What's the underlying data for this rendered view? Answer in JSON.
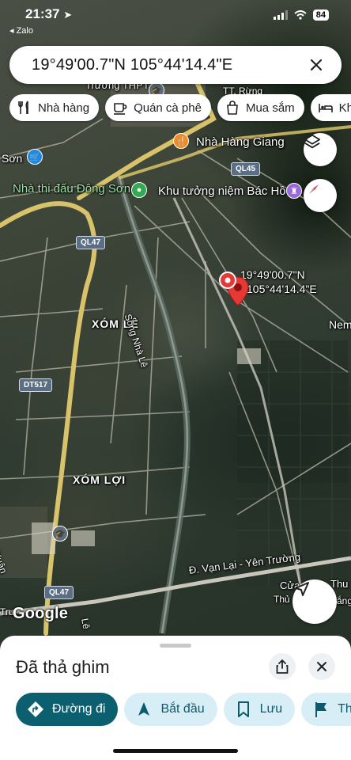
{
  "status_bar": {
    "time": "21:37",
    "back_app": "◂ Zalo",
    "battery": "84"
  },
  "search": {
    "query": "19°49'00.7\"N 105°44'14.4\"E"
  },
  "categories": [
    {
      "label": "Nhà hàng",
      "icon": "restaurant-icon"
    },
    {
      "label": "Quán cà phê",
      "icon": "coffee-icon"
    },
    {
      "label": "Mua sắm",
      "icon": "shopping-bag-icon"
    },
    {
      "label": "Khá",
      "icon": "hotel-icon"
    }
  ],
  "map": {
    "labels": {
      "school": "Trường THPT",
      "town": "TT. Rừng",
      "restaurant": "Nhà Hàng Giang",
      "son": "Sơn",
      "stadium": "Nhà thi đấu Đông Sơn",
      "memorial": "Khu tưởng niệm Bác Hồ",
      "pin_lat": "19°49'00.7\"N",
      "pin_lng": "105°44'14.4\"E",
      "nem": "Nem",
      "xom_le": "XÓM LÊ",
      "river": "Sông Nhà Lê",
      "xom_loi": "XÓM LỢI",
      "road": "Đ. Vạn Lại - Yên Trường",
      "cua": "Cửa",
      "thu_right": "Thu",
      "thu_bottom": "Thủ",
      "thang": "Thắng M",
      "xuan": "Xuân",
      "tru": "Trư",
      "le_bottom": "Lê"
    },
    "shields": {
      "ql45": "QL45",
      "ql47_top": "QL47",
      "dt517": "DT517",
      "ql47_bottom": "QL47"
    },
    "google_logo": "Google"
  },
  "sheet": {
    "title": "Đã thả ghim",
    "actions": [
      {
        "label": "Đường đi",
        "icon": "directions-icon"
      },
      {
        "label": "Bắt đầu",
        "icon": "navigation-arrow-icon"
      },
      {
        "label": "Lưu",
        "icon": "bookmark-icon"
      },
      {
        "label": "Thê",
        "icon": "flag-icon"
      }
    ]
  },
  "colors": {
    "accent": "#0b5f6f",
    "action_bg": "#d8eef6",
    "pin": "#e53935",
    "major_road": "#d9c36a"
  }
}
